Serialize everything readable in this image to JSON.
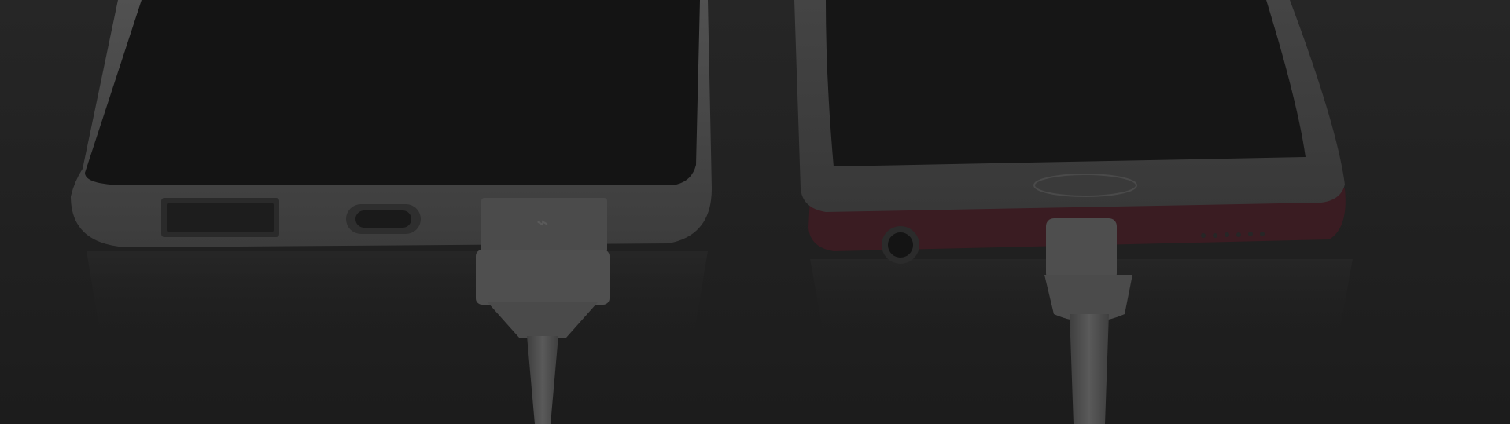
{
  "scene": {
    "description_colors": {
      "background": "#202020",
      "left_phone_case": "#4a4a4a",
      "left_phone_screen": "#141414",
      "right_phone_body": "#3a3a3a",
      "right_phone_accent": "#3a1c22",
      "cable": "#555555"
    },
    "icons": [
      "usb-port-icon",
      "usb-c-port-icon",
      "audio-jack-icon",
      "charging-cable-icon"
    ]
  }
}
